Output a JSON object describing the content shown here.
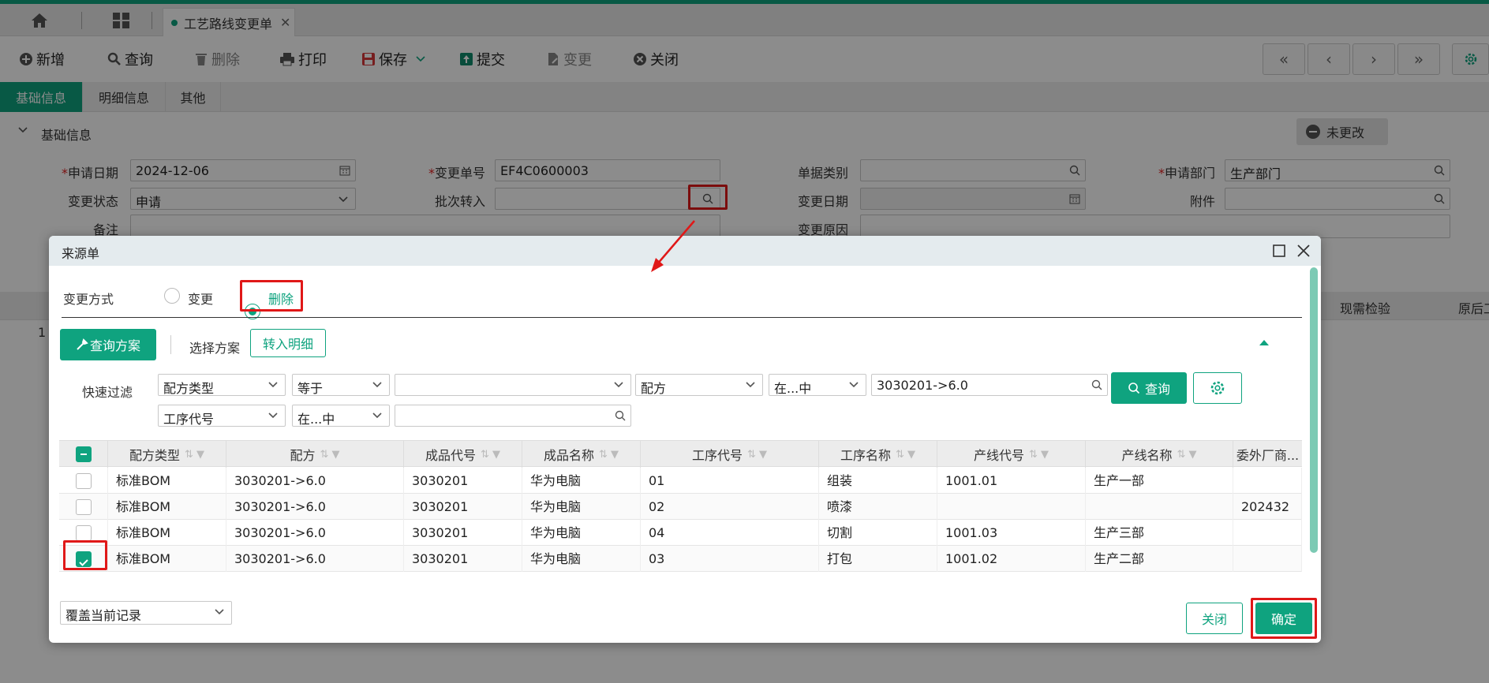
{
  "tabs": {
    "active_tab": "工艺路线变更单"
  },
  "toolbar": {
    "new": "新增",
    "query": "查询",
    "delete": "删除",
    "print": "打印",
    "save": "保存",
    "submit": "提交",
    "change": "变更",
    "close": "关闭",
    "nav": [
      "«",
      "‹",
      "›",
      "»"
    ]
  },
  "subtabs": [
    "基础信息",
    "明细信息",
    "其他"
  ],
  "section": {
    "title": "基础信息",
    "status_badge": "未更改"
  },
  "form": {
    "apply_date_label": "申请日期",
    "apply_date": "2024-12-06",
    "change_no_label": "变更单号",
    "change_no": "EF4C0600003",
    "doc_type_label": "单据类别",
    "doc_type": "",
    "dept_label": "申请部门",
    "dept": "生产部门",
    "change_status_label": "变更状态",
    "change_status": "申请",
    "batch_label": "批次转入",
    "batch": "",
    "change_date_label": "变更日期",
    "change_date": "",
    "attach_label": "附件",
    "attach": "",
    "remark_label": "备注",
    "reason_label": "变更原因"
  },
  "behind_grid": {
    "col_a": "现需检验",
    "col_b": "原后工",
    "row_no": "1"
  },
  "modal": {
    "title": "来源单",
    "change_mode_label": "变更方式",
    "opt_change": "变更",
    "opt_delete": "删除",
    "query_scheme_btn": "查询方案",
    "select_scheme_label": "选择方案",
    "transfer_btn": "转入明细",
    "quick_filter_label": "快速过滤",
    "filters": {
      "f1_field": "配方类型",
      "f1_op": "等于",
      "f1_val": "",
      "f2_field": "配方",
      "f2_op": "在...中",
      "f2_val": "3030201->6.0",
      "f3_field": "工序代号",
      "f3_op": "在...中",
      "f3_val": ""
    },
    "query_btn": "查询",
    "columns": [
      "配方类型",
      "配方",
      "成品代号",
      "成品名称",
      "工序代号",
      "工序名称",
      "产线代号",
      "产线名称",
      "委外厂商..."
    ],
    "rows": [
      {
        "c1": "标准BOM",
        "c2": "3030201->6.0",
        "c3": "3030201",
        "c4": "华为电脑",
        "c5": "01",
        "c6": "组装",
        "c7": "1001.01",
        "c8": "生产一部",
        "c9": "",
        "checked": false
      },
      {
        "c1": "标准BOM",
        "c2": "3030201->6.0",
        "c3": "3030201",
        "c4": "华为电脑",
        "c5": "02",
        "c6": "喷漆",
        "c7": "",
        "c8": "",
        "c9": "202432",
        "checked": false
      },
      {
        "c1": "标准BOM",
        "c2": "3030201->6.0",
        "c3": "3030201",
        "c4": "华为电脑",
        "c5": "04",
        "c6": "切割",
        "c7": "1001.03",
        "c8": "生产三部",
        "c9": "",
        "checked": false
      },
      {
        "c1": "标准BOM",
        "c2": "3030201->6.0",
        "c3": "3030201",
        "c4": "华为电脑",
        "c5": "03",
        "c6": "打包",
        "c7": "1001.02",
        "c8": "生产二部",
        "c9": "",
        "checked": true
      }
    ],
    "cover_select": "覆盖当前记录",
    "close_btn": "关闭",
    "ok_btn": "确定"
  },
  "colors": {
    "accent": "#0fa37f",
    "highlight": "#e01818"
  }
}
